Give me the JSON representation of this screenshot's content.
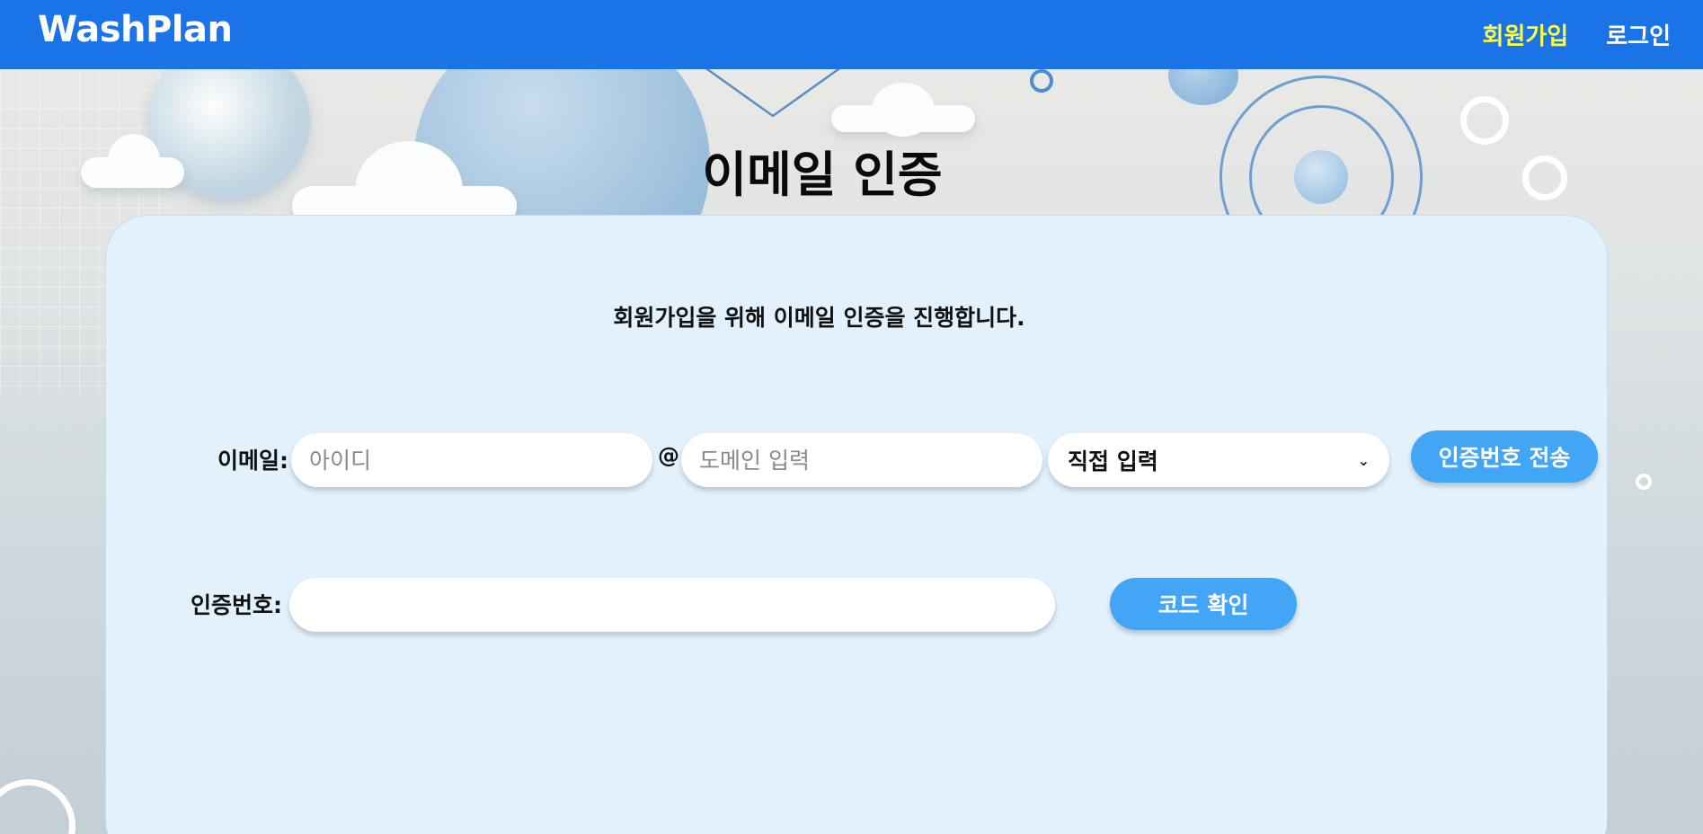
{
  "header": {
    "brand": "WashPlan",
    "nav": {
      "signup": "회원가입",
      "login": "로그인"
    },
    "bg_color": "#1b73e8",
    "active_color": "#ffff3a"
  },
  "page": {
    "title": "이메일 인증",
    "intro": "회원가입을 위해 이메일 인증을 진행합니다."
  },
  "form": {
    "email_label": "이메일:",
    "id_placeholder": "아이디",
    "id_value": "",
    "at": "@",
    "domain_placeholder": "도메인 입력",
    "domain_value": "",
    "domain_select": "직접 입력",
    "send_button": "인증번호 전송",
    "code_label": "인증번호:",
    "code_value": "",
    "verify_button": "코드 확인",
    "button_color": "#42a5f5"
  }
}
